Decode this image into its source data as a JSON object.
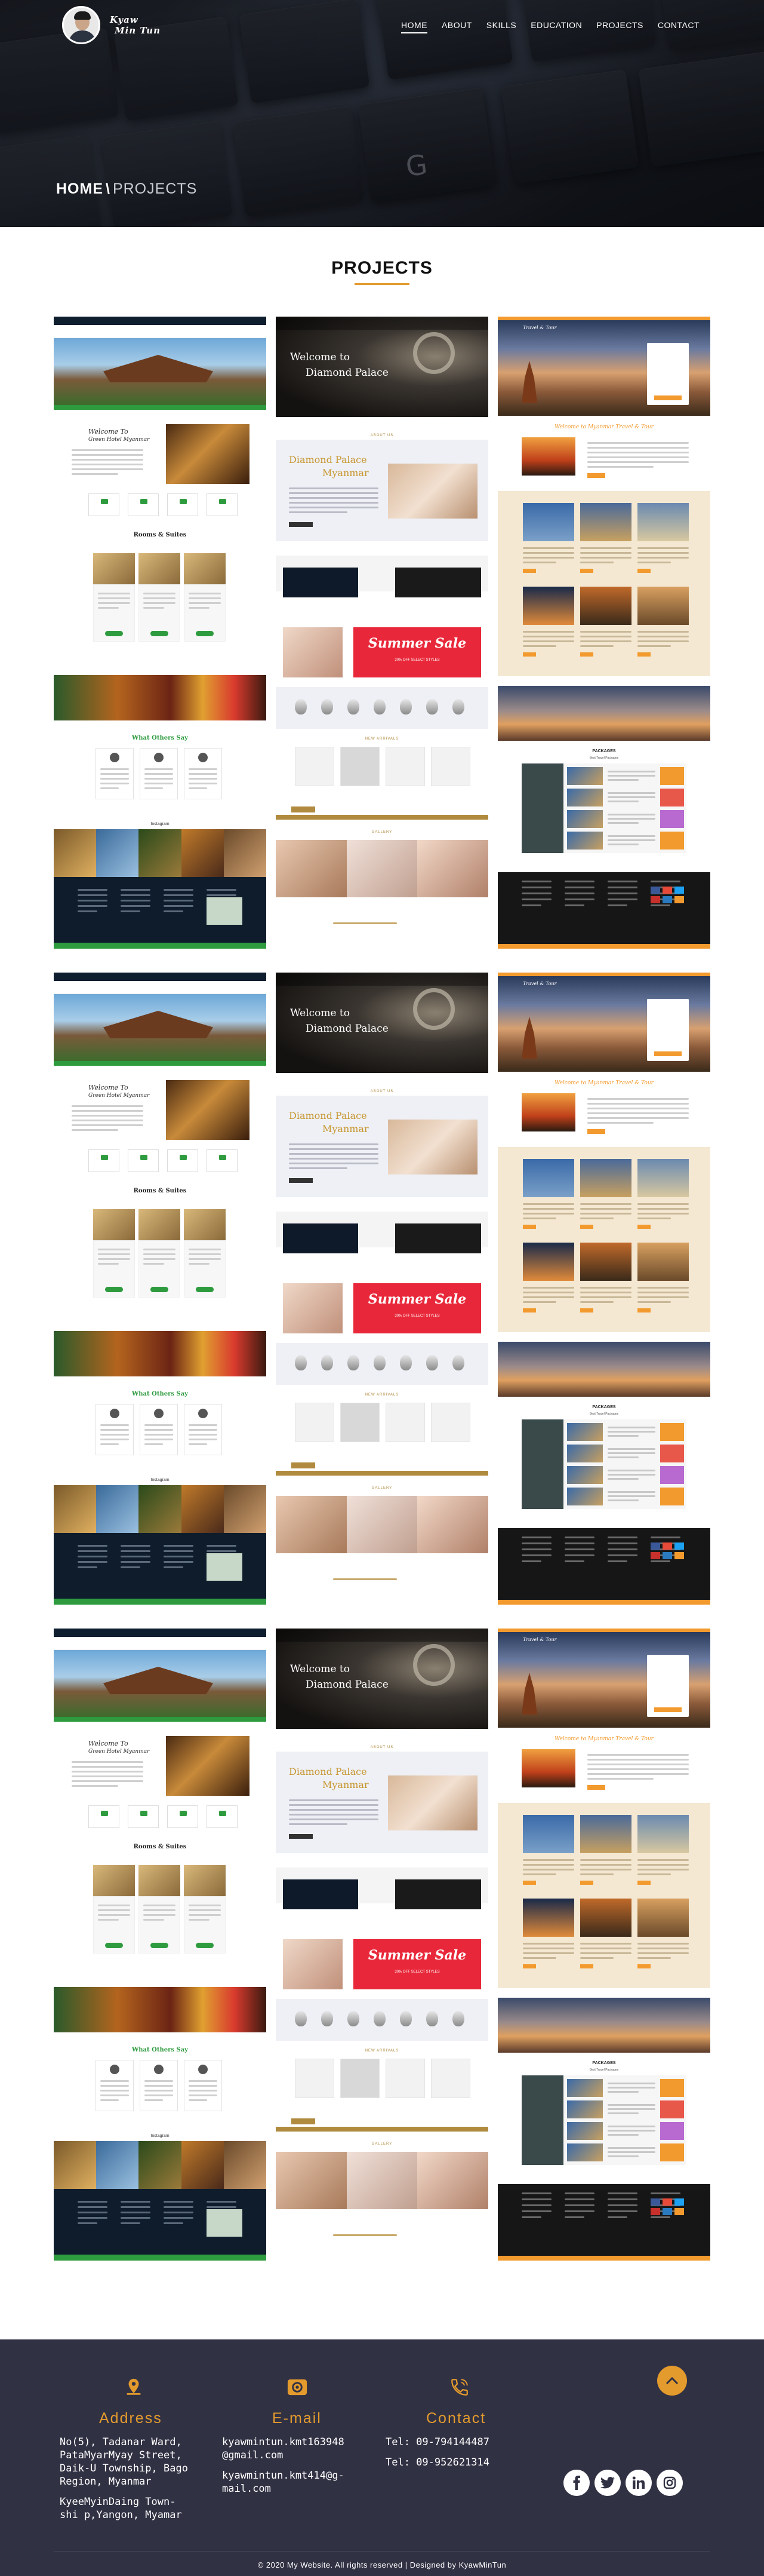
{
  "header": {
    "brand_line1": "Kyaw",
    "brand_line2": "Min Tun",
    "nav": [
      "HOME",
      "ABOUT",
      "SKILLS",
      "EDUCATION",
      "PROJECTS",
      "CONTACT"
    ],
    "active_nav": "HOME"
  },
  "breadcrumb": {
    "home": "HOME",
    "separator": "\\",
    "current": "PROJECTS"
  },
  "projects": {
    "title": "PROJECTS",
    "rows": 3,
    "columns": [
      "hotel-website",
      "jewelry-website",
      "travel-website"
    ]
  },
  "mock": {
    "hotel": {
      "welcome_line1": "Welcome To",
      "welcome_line2": "Green Hotel Myanmar",
      "rooms_title": "Rooms & Suites",
      "testimonials_title": "What Others Say",
      "instagram": "Instagram"
    },
    "jewelry": {
      "hero_line1": "Welcome to",
      "hero_line2": "Diamond Palace",
      "about_tag": "ABOUT US",
      "brand_line1": "Diamond Palace",
      "brand_line2": "Myanmar",
      "sale": "Summer Sale",
      "sale_sub": "30% OFF SELECT STYLES",
      "new_arrivals": "NEW ARRIVALS",
      "gallery": "GALLERY"
    },
    "travel": {
      "logo": "Travel & Tour",
      "welcome": "Welcome to Myanmar Travel & Tour",
      "packages": "PACKAGES",
      "packages_sub": "Best Travel Packages"
    }
  },
  "footer": {
    "address_heading": "Address",
    "address_lines": [
      "No(5), Tadanar Ward,",
      "PataMyarMyay Street,",
      "Daik-U Township, Bago",
      "Region, Myanmar",
      "",
      "KyeeMyinDaing Town-",
      "shi p,Yangon, Myamar"
    ],
    "email_heading": "E-mail",
    "email_lines": [
      "kyawmintun.kmt163948",
      "@gmail.com",
      "",
      "kyawmintun.kmt414@g-",
      "mail.com"
    ],
    "contact_heading": "Contact",
    "phone_lines": [
      "Tel: 09-794144487",
      "",
      "Tel: 09-952621314"
    ],
    "social": [
      "facebook-icon",
      "twitter-icon",
      "linkedin-icon",
      "instagram-icon"
    ],
    "copyright": "© 2020 My Website. All rights reserved | Designed by KyawMinTun"
  },
  "colors": {
    "accent": "#e39b2d",
    "footer_bg": "#313144",
    "hotel_green": "#2e9b3e",
    "jewel_gold": "#b08a3e",
    "sale_red": "#e8283a",
    "travel_orange": "#f29a2e"
  }
}
